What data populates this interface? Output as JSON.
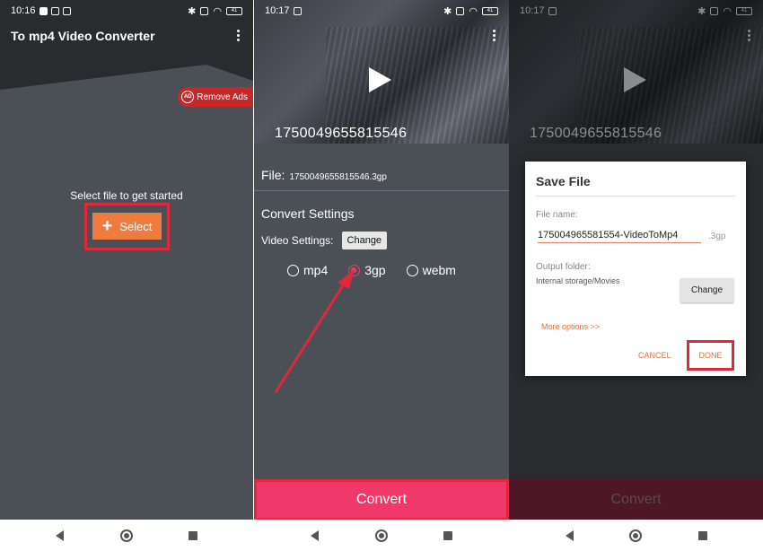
{
  "panel1": {
    "status_time": "10:16",
    "battery": "41",
    "app_title": "To mp4 Video Converter",
    "remove_ads": "Remove Ads",
    "ad_badge": "AD",
    "prompt": "Select file to get started",
    "select_label": "Select"
  },
  "panel2": {
    "status_time": "10:17",
    "battery": "41",
    "video_id": "1750049655815546",
    "file_label": "File:",
    "file_value": "1750049655815546.3gp",
    "convert_settings": "Convert Settings",
    "video_settings_label": "Video Settings:",
    "change_label": "Change",
    "formats": [
      "mp4",
      "3gp",
      "webm"
    ],
    "selected_format": "3gp",
    "convert_label": "Convert"
  },
  "panel3": {
    "status_time": "10:17",
    "battery": "41",
    "video_id": "1750049655815546",
    "dialog": {
      "title": "Save File",
      "file_name_label": "File name:",
      "file_name_value": "175004965581554-VideoToMp4",
      "extension": ".3gp",
      "output_folder_label": "Output folder:",
      "output_folder_value": "Internal storage/Movies",
      "change_label": "Change",
      "more_options": "More options >>",
      "cancel_label": "CANCEL",
      "done_label": "DONE"
    },
    "convert_label": "Convert"
  },
  "colors": {
    "accent_orange": "#f07b3e",
    "accent_pink": "#f0386a",
    "highlight_red": "#e0283c",
    "panel_bg": "#4b4f56"
  }
}
